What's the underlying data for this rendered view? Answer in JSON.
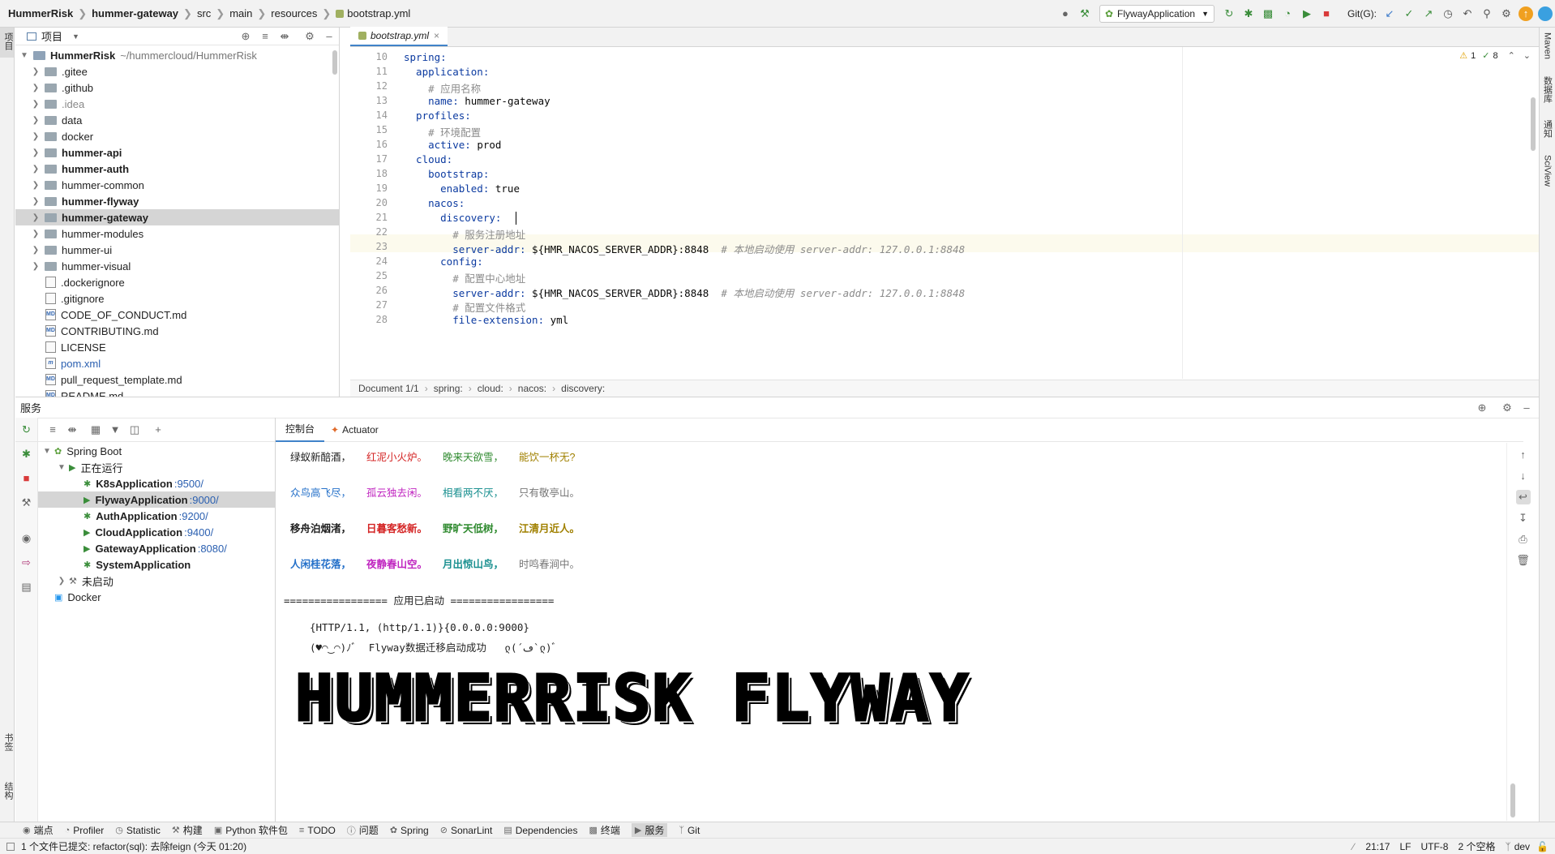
{
  "nav": {
    "crumbs": [
      "HummerRisk",
      "hummer-gateway",
      "src",
      "main",
      "resources",
      "bootstrap.yml"
    ],
    "run_config": "FlywayApplication",
    "git_label": "Git(G):"
  },
  "left_strip": {
    "top": "项目",
    "bottom1": "书签",
    "bottom2": "结构"
  },
  "right_strip": {
    "items": [
      "Maven",
      "数据库",
      "通知",
      "SciView"
    ]
  },
  "project": {
    "header": "项目",
    "root": "HummerRisk",
    "root_path": "~/hummercloud/HummerRisk",
    "items": [
      {
        "name": ".gitee",
        "kind": "folder",
        "bold": false,
        "dim": false
      },
      {
        "name": ".github",
        "kind": "folder",
        "bold": false,
        "dim": false
      },
      {
        "name": ".idea",
        "kind": "folder",
        "bold": false,
        "dim": true
      },
      {
        "name": "data",
        "kind": "folder",
        "bold": false,
        "dim": false
      },
      {
        "name": "docker",
        "kind": "folder",
        "bold": false,
        "dim": false
      },
      {
        "name": "hummer-api",
        "kind": "folder",
        "bold": true,
        "dim": false
      },
      {
        "name": "hummer-auth",
        "kind": "folder",
        "bold": true,
        "dim": false
      },
      {
        "name": "hummer-common",
        "kind": "folder",
        "bold": false,
        "dim": false
      },
      {
        "name": "hummer-flyway",
        "kind": "folder",
        "bold": true,
        "dim": false
      },
      {
        "name": "hummer-gateway",
        "kind": "folder",
        "bold": true,
        "dim": false
      },
      {
        "name": "hummer-modules",
        "kind": "folder",
        "bold": false,
        "dim": false
      },
      {
        "name": "hummer-ui",
        "kind": "folder",
        "bold": false,
        "dim": false
      },
      {
        "name": "hummer-visual",
        "kind": "folder",
        "bold": false,
        "dim": false
      },
      {
        "name": ".dockerignore",
        "kind": "file",
        "bold": false,
        "dim": false
      },
      {
        "name": ".gitignore",
        "kind": "file",
        "bold": false,
        "dim": false
      },
      {
        "name": "CODE_OF_CONDUCT.md",
        "kind": "md",
        "bold": false,
        "dim": false
      },
      {
        "name": "CONTRIBUTING.md",
        "kind": "md",
        "bold": false,
        "dim": false
      },
      {
        "name": "LICENSE",
        "kind": "file",
        "bold": false,
        "dim": false
      },
      {
        "name": "pom.xml",
        "kind": "pom",
        "bold": false,
        "dim": false
      },
      {
        "name": "pull_request_template.md",
        "kind": "md",
        "bold": false,
        "dim": false
      },
      {
        "name": "README.md",
        "kind": "md",
        "bold": false,
        "dim": false
      }
    ]
  },
  "editor": {
    "tab": "bootstrap.yml",
    "warnings": "1",
    "checks": "8",
    "lines": [
      {
        "n": "10",
        "t": "spring:",
        "c": "k"
      },
      {
        "n": "11",
        "t": "  application:",
        "c": "k"
      },
      {
        "n": "12",
        "t": "    # 应用名称",
        "c": "cm"
      },
      {
        "n": "13",
        "t": "    name: hummer-gateway",
        "c": "k"
      },
      {
        "n": "14",
        "t": "  profiles:",
        "c": "k"
      },
      {
        "n": "15",
        "t": "    # 环境配置",
        "c": "cm"
      },
      {
        "n": "16",
        "t": "    active: prod",
        "c": "k"
      },
      {
        "n": "17",
        "t": "  cloud:",
        "c": "k"
      },
      {
        "n": "18",
        "t": "    bootstrap:",
        "c": "k"
      },
      {
        "n": "19",
        "t": "      enabled: true",
        "c": "k"
      },
      {
        "n": "20",
        "t": "    nacos:",
        "c": "k"
      },
      {
        "n": "21",
        "t": "      discovery:",
        "c": "k"
      },
      {
        "n": "22",
        "t": "        # 服务注册地址",
        "c": "cm"
      },
      {
        "n": "23",
        "t": "        server-addr: ${HMR_NACOS_SERVER_ADDR}:8848  # 本地启动使用 server-addr: 127.0.0.1:8848",
        "c": "k"
      },
      {
        "n": "24",
        "t": "      config:",
        "c": "k"
      },
      {
        "n": "25",
        "t": "        # 配置中心地址",
        "c": "cm"
      },
      {
        "n": "26",
        "t": "        server-addr: ${HMR_NACOS_SERVER_ADDR}:8848  # 本地启动使用 server-addr: 127.0.0.1:8848",
        "c": "k"
      },
      {
        "n": "27",
        "t": "        # 配置文件格式",
        "c": "cm"
      },
      {
        "n": "28",
        "t": "        file-extension: yml",
        "c": "k"
      }
    ],
    "breadcrumb": [
      "Document 1/1",
      "spring:",
      "cloud:",
      "nacos:",
      "discovery:"
    ]
  },
  "services": {
    "title": "服务",
    "tree": [
      {
        "label": "Spring Boot",
        "port": "",
        "level": 0,
        "bold": false
      },
      {
        "label": "正在运行",
        "port": "",
        "level": 1,
        "bold": false
      },
      {
        "label": "K8sApplication",
        "port": ":9500/",
        "level": 2,
        "bold": true
      },
      {
        "label": "FlywayApplication",
        "port": ":9000/",
        "level": 2,
        "bold": true
      },
      {
        "label": "AuthApplication",
        "port": ":9200/",
        "level": 2,
        "bold": true
      },
      {
        "label": "CloudApplication",
        "port": ":9400/",
        "level": 2,
        "bold": true
      },
      {
        "label": "GatewayApplication",
        "port": ":8080/",
        "level": 2,
        "bold": true
      },
      {
        "label": "SystemApplication",
        "port": "",
        "level": 2,
        "bold": true
      },
      {
        "label": "未启动",
        "port": "",
        "level": 1,
        "bold": false
      },
      {
        "label": "Docker",
        "port": "",
        "level": 0,
        "bold": false
      }
    ],
    "tabs": [
      "控制台",
      "Actuator"
    ],
    "poem": [
      [
        "绿蚁新醅酒，",
        "红泥小火炉。",
        "晚来天欲雪，",
        "能饮一杯无?"
      ],
      [
        "众鸟高飞尽，",
        "孤云独去闲。",
        "相看两不厌，",
        "只有敬亭山。"
      ],
      [
        "移舟泊烟渚，",
        "日暮客愁新。",
        "野旷天低树，",
        "江清月近人。"
      ],
      [
        "人闲桂花落，",
        "夜静春山空。",
        "月出惊山鸟，",
        "时鸣春涧中。"
      ]
    ],
    "started": "================= 应用已启动 =================",
    "http": "{HTTP/1.1, (http/1.1)}{0.0.0.0:9000}",
    "flyway_msg": "(♥◠‿◠)ﾉﾞ  Flyway数据迁移启动成功   ლ(´ڡ`ლ)ﾞ",
    "banner": "HUMMERRISK FLYWAY"
  },
  "bottom_tools": [
    "端点",
    "Profiler",
    "Statistic",
    "构建",
    "Python 软件包",
    "TODO",
    "问题",
    "Spring",
    "SonarLint",
    "Dependencies",
    "终端",
    "服务",
    "Git"
  ],
  "status": {
    "commit": "1 个文件已提交: refactor(sql): 去除feign (今天 01:20)",
    "pos": "21:17",
    "lf": "LF",
    "enc": "UTF-8",
    "indent": "2 个空格",
    "branch": "dev"
  }
}
